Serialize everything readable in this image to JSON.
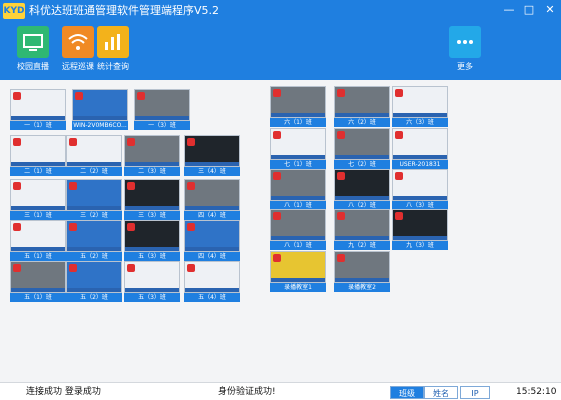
{
  "app_title": "科优达班班通管理软件管理端程序V5.2",
  "logo_text": "KYD",
  "window_controls": {
    "min": "—",
    "max": "□",
    "close": "✕"
  },
  "toolbar": {
    "campus": {
      "label": "校园直播",
      "icon": "monitor-icon",
      "color": "#2fb873"
    },
    "remote": {
      "label": "远程巡课",
      "icon": "wifi-icon",
      "color": "#f08a24"
    },
    "stats": {
      "label": "统计查询",
      "icon": "bar-chart-icon",
      "color": "#f3b21b"
    },
    "more": {
      "label": "更多",
      "icon": "more-icon",
      "color": "#23a8e8"
    }
  },
  "tiles": [
    {
      "label": "一（1）班",
      "style": "light"
    },
    {
      "label": "WIN-2V0MB6CO...",
      "style": "blue"
    },
    {
      "label": "一（3）班",
      "style": "gray"
    },
    {
      "label": "二（1）班",
      "style": "light"
    },
    {
      "label": "二（2）班",
      "style": "light"
    },
    {
      "label": "二（3）班",
      "style": "gray"
    },
    {
      "label": "三（4）班",
      "style": "dark"
    },
    {
      "label": "三（1）班",
      "style": "light"
    },
    {
      "label": "三（2）班",
      "style": "blue"
    },
    {
      "label": "三（3）班",
      "style": "dark"
    },
    {
      "label": "四（4）班",
      "style": "gray"
    },
    {
      "label": "五（1）班",
      "style": "light"
    },
    {
      "label": "五（2）班",
      "style": "blue"
    },
    {
      "label": "五（3）班",
      "style": "dark"
    },
    {
      "label": "四（4）班",
      "style": "blue"
    },
    {
      "label": "五（1）班",
      "style": "gray"
    },
    {
      "label": "五（2）班",
      "style": "blue"
    },
    {
      "label": "五（3）班",
      "style": "light"
    },
    {
      "label": "五（4）班",
      "style": "light"
    },
    {
      "label": "六（1）班",
      "style": "gray"
    },
    {
      "label": "六（2）班",
      "style": "gray"
    },
    {
      "label": "六（3）班",
      "style": "light"
    },
    {
      "label": "七（1）班",
      "style": "light"
    },
    {
      "label": "七（2）班",
      "style": "gray"
    },
    {
      "label": "USER-201831",
      "style": "light"
    },
    {
      "label": "八（1）班",
      "style": "gray"
    },
    {
      "label": "八（2）班",
      "style": "dark"
    },
    {
      "label": "八（3）班",
      "style": "light"
    },
    {
      "label": "八（1）班",
      "style": "gray"
    },
    {
      "label": "九（2）班",
      "style": "gray"
    },
    {
      "label": "九（3）班",
      "style": "dark"
    },
    {
      "label": "录播教室1",
      "style": "yellow"
    },
    {
      "label": "录播教室2",
      "style": "gray"
    }
  ],
  "status": {
    "left": "连接成功  登录成功",
    "center": "身份验证成功!",
    "tab_class": "班级",
    "tab_name": "姓名",
    "tab_ip": "IP",
    "time": "15:52:10"
  }
}
